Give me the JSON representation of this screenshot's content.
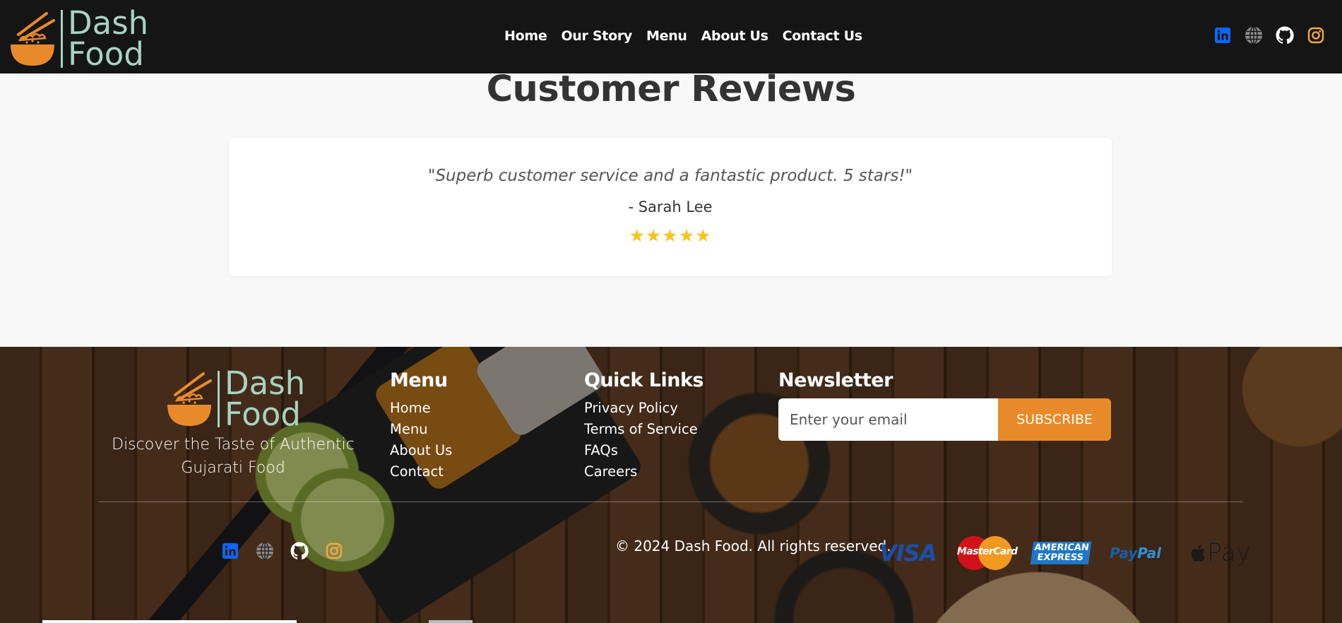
{
  "brand": {
    "line1": "Dash",
    "line2": "Food"
  },
  "nav": {
    "items": [
      "Home",
      "Our Story",
      "Menu",
      "About Us",
      "Contact Us"
    ]
  },
  "social_icons": [
    "linkedin-icon",
    "globe-icon",
    "github-icon",
    "instagram-icon"
  ],
  "colors": {
    "header_bg": "#151515",
    "brand_text": "#a7d3c2",
    "bowl_orange": "#e98a2a",
    "accent": "#e98a2a",
    "star": "#f5c518",
    "linkedin": "#0a66ff",
    "instagram": "#f5a742"
  },
  "reviews": {
    "title": "Customer Reviews",
    "quote": "\"Superb customer service and a fantastic product. 5 stars!\"",
    "author": "- Sarah Lee",
    "stars": "★★★★★",
    "rating": 5
  },
  "footer": {
    "tagline": "Discover the Taste of Authentic Gujarati Food",
    "menu": {
      "title": "Menu",
      "links": [
        "Home",
        "Menu",
        "About Us",
        "Contact"
      ]
    },
    "quick_links": {
      "title": "Quick Links",
      "links": [
        "Privacy Policy",
        "Terms of Service",
        "FAQs",
        "Careers"
      ]
    },
    "newsletter": {
      "title": "Newsletter",
      "placeholder": "Enter your email",
      "button": "SUBSCRIBE"
    },
    "copyright": "© 2024 Dash Food. All rights reserved.",
    "payments": {
      "visa": "VISA",
      "mastercard": "MasterCard",
      "amex_line1": "AMERICAN",
      "amex_line2": "EXPRESS",
      "paypal_1": "Pay",
      "paypal_2": "Pal",
      "apple_pay": "Pay"
    }
  }
}
